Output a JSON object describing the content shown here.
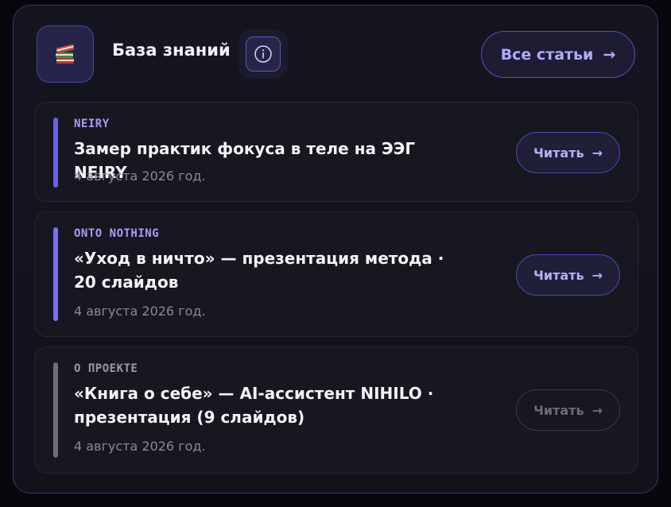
{
  "header": {
    "title": "База знаний",
    "book_icon": "books-icon",
    "info_icon": "info-icon",
    "all_articles_label": "Все статьи",
    "arrow": "→"
  },
  "articles": [
    {
      "category": "NEIRY",
      "title": "Замер практик фокуса в теле на ЭЭГ NEIRY",
      "date": "4 августа 2026 год.",
      "read_label": "Читать",
      "arrow": "→",
      "accent": "#6b61e8"
    },
    {
      "category": "ONTO NOTHING",
      "title": "«Уход в ничто» — презентация метода · 20 слайдов",
      "date": "4 августа 2026 год.",
      "read_label": "Читать",
      "arrow": "→",
      "accent": "#7e6ef0"
    },
    {
      "category": "О ПРОЕКТЕ",
      "title": "«Книга о себе» — AI-ассистент NIHILO · презентация (9 слайдов)",
      "date": "4 августа 2026 год.",
      "read_label": "Читать",
      "arrow": "→",
      "accent": "#6e6e78"
    }
  ],
  "colors": {
    "accent": "#7c6ff0",
    "category_active": "#a79cff",
    "category_muted": "#9a9aa6"
  }
}
